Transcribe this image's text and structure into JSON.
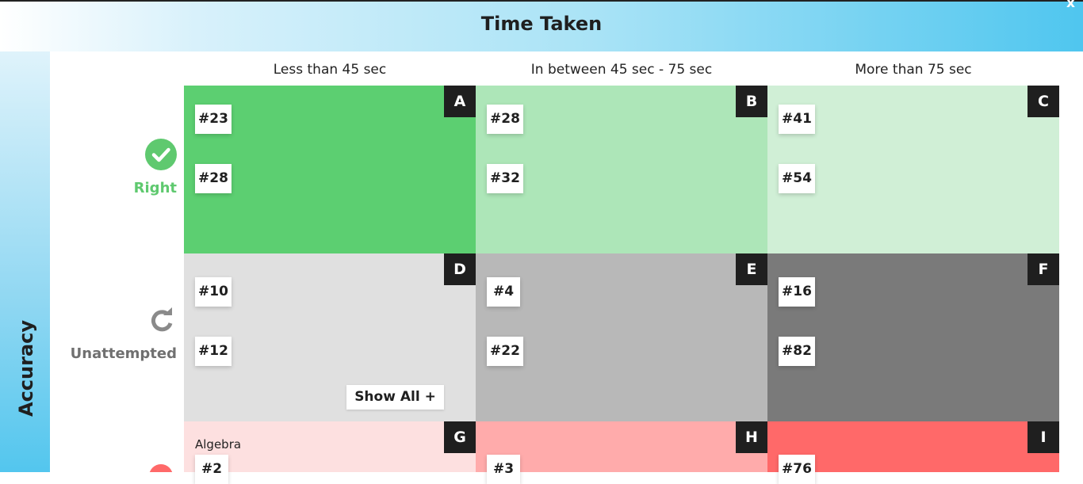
{
  "header": {
    "title": "Time Taken",
    "close": "x"
  },
  "side": {
    "title": "Accuracy"
  },
  "columns": [
    "Less than 45 sec",
    "In between 45 sec - 75 sec",
    "More than 75 sec"
  ],
  "rows": {
    "right": {
      "label": "Right",
      "color": "#5fc96f",
      "icon": "checkmark-circle-icon"
    },
    "unattempted": {
      "label": "Unattempted",
      "color": "#707070",
      "icon": "retry-arrow-icon"
    }
  },
  "cells": {
    "A": {
      "letter": "A",
      "bg": "#5ccf71",
      "items": [
        "#23",
        "#28"
      ]
    },
    "B": {
      "letter": "B",
      "bg": "#ade6b8",
      "items": [
        "#28",
        "#32"
      ]
    },
    "C": {
      "letter": "C",
      "bg": "#d0efd6",
      "items": [
        "#41",
        "#54"
      ]
    },
    "D": {
      "letter": "D",
      "bg": "#e0e0e0",
      "items": [
        "#10",
        "#12"
      ],
      "show_all": "Show All +"
    },
    "E": {
      "letter": "E",
      "bg": "#b8b8b8",
      "items": [
        "#4",
        "#22"
      ]
    },
    "F": {
      "letter": "F",
      "bg": "#7a7a7a",
      "items": [
        "#16",
        "#82"
      ]
    },
    "G": {
      "letter": "G",
      "bg": "#fde0e0",
      "topic": "Algebra",
      "items": [
        "#2"
      ]
    },
    "H": {
      "letter": "H",
      "bg": "#ffabab",
      "items": [
        "#3"
      ]
    },
    "I": {
      "letter": "I",
      "bg": "#ff6969",
      "items": [
        "#76"
      ]
    }
  }
}
